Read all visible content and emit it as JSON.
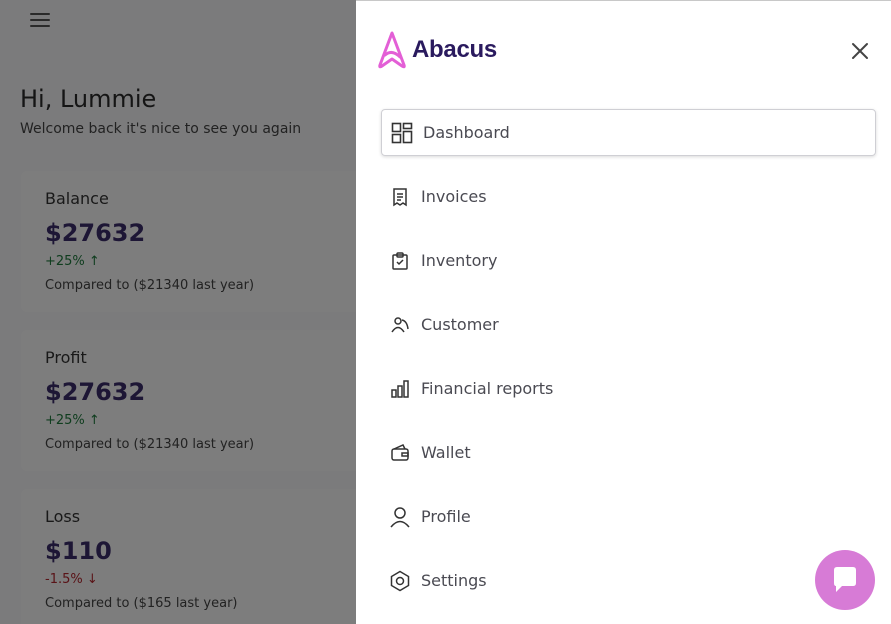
{
  "background": {
    "greeting": "Hi, Lummie",
    "welcome": "Welcome back it's nice to see you again",
    "cards": [
      {
        "title": "Balance",
        "value": "$27632",
        "change": "+25%",
        "direction": "up",
        "compare": "Compared to ($21340 last year)"
      },
      {
        "title": "Profit",
        "value": "$27632",
        "change": "+25%",
        "direction": "up",
        "compare": "Compared to ($21340 last year)"
      },
      {
        "title": "Loss",
        "value": "$110",
        "change": "-1.5%",
        "direction": "down",
        "compare": "Compared to ($165 last year)"
      }
    ]
  },
  "drawer": {
    "brand": "Abacus",
    "menu": [
      {
        "label": "Dashboard",
        "icon": "dashboard-icon",
        "active": true
      },
      {
        "label": "Invoices",
        "icon": "invoice-icon"
      },
      {
        "label": "Inventory",
        "icon": "clipboard-check-icon"
      },
      {
        "label": "Customer",
        "icon": "customer-icon"
      },
      {
        "label": "Financial reports",
        "icon": "bar-chart-icon"
      },
      {
        "label": "Wallet",
        "icon": "wallet-icon"
      },
      {
        "label": "Profile",
        "icon": "user-icon"
      },
      {
        "label": "Settings",
        "icon": "settings-icon"
      }
    ]
  },
  "colors": {
    "brand_pink": "#e35fd6",
    "brand_navy": "#2a1a5e",
    "chat_button": "#d77bd6",
    "positive": "#1f7a3d",
    "negative": "#b3262e"
  }
}
